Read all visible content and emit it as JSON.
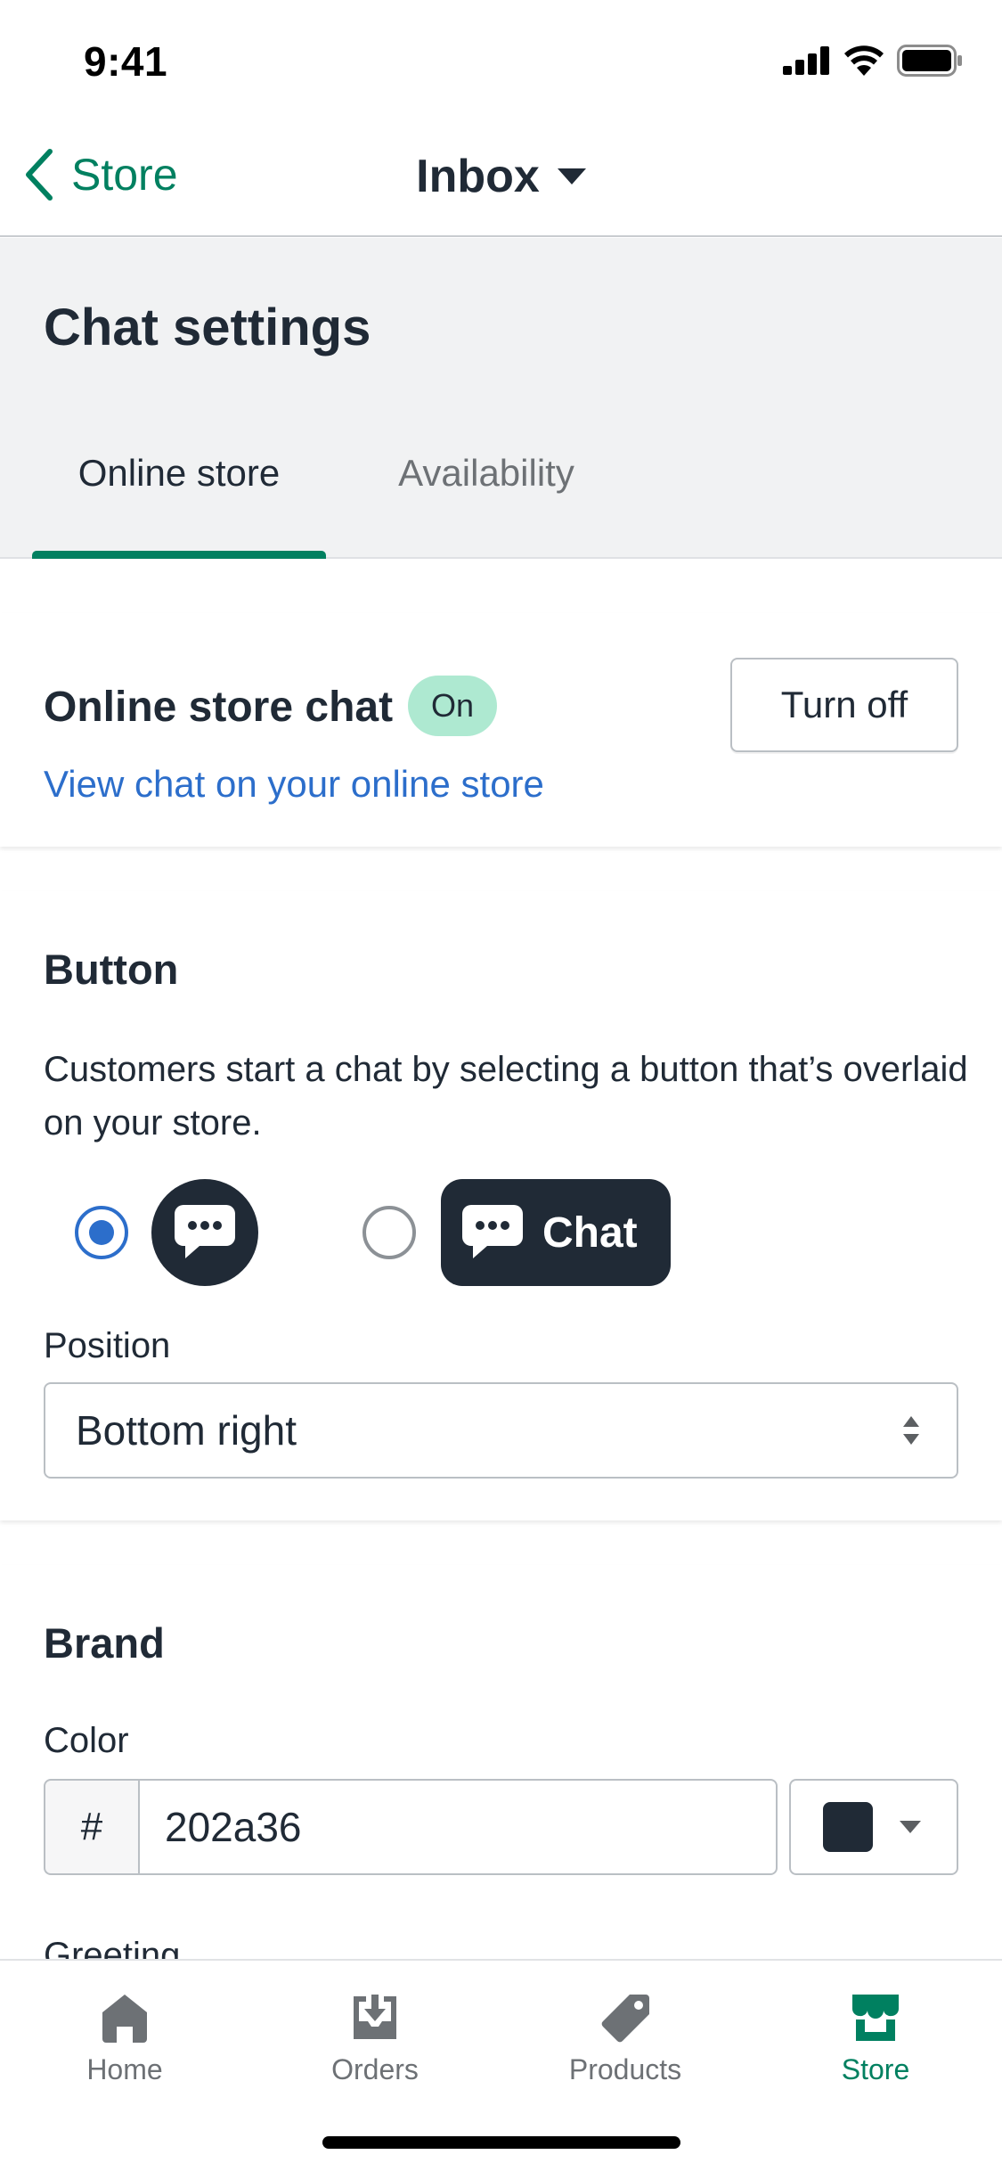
{
  "status": {
    "time": "9:41"
  },
  "nav": {
    "back_label": "Store",
    "title": "Inbox"
  },
  "header": {
    "title": "Chat settings",
    "tabs": [
      {
        "label": "Online store",
        "active": true
      },
      {
        "label": "Availability",
        "active": false
      }
    ]
  },
  "chat_card": {
    "title": "Online store chat",
    "badge": "On",
    "turn_off_label": "Turn off",
    "link": "View chat on your online store"
  },
  "button_section": {
    "heading": "Button",
    "description": "Customers start a chat by selecting a button that’s overlaid on your store.",
    "options": [
      {
        "style": "icon-only",
        "selected": true
      },
      {
        "style": "icon-with-label",
        "label": "Chat",
        "selected": false
      }
    ],
    "position_label": "Position",
    "position_value": "Bottom right"
  },
  "brand_section": {
    "heading": "Brand",
    "color_label": "Color",
    "hex_prefix": "#",
    "hex_value": "202a36",
    "swatch_color": "#202a36",
    "next_label_cut": "Greeting"
  },
  "tab_bar": {
    "items": [
      {
        "label": "Home",
        "icon": "home-icon",
        "active": false
      },
      {
        "label": "Orders",
        "icon": "orders-icon",
        "active": false
      },
      {
        "label": "Products",
        "icon": "tag-icon",
        "active": false
      },
      {
        "label": "Store",
        "icon": "store-icon",
        "active": true
      }
    ]
  },
  "colors": {
    "accent": "#008060",
    "link": "#2c6ecb",
    "text": "#202a36",
    "badge_bg": "#aee9d1",
    "muted": "#6d7175"
  }
}
